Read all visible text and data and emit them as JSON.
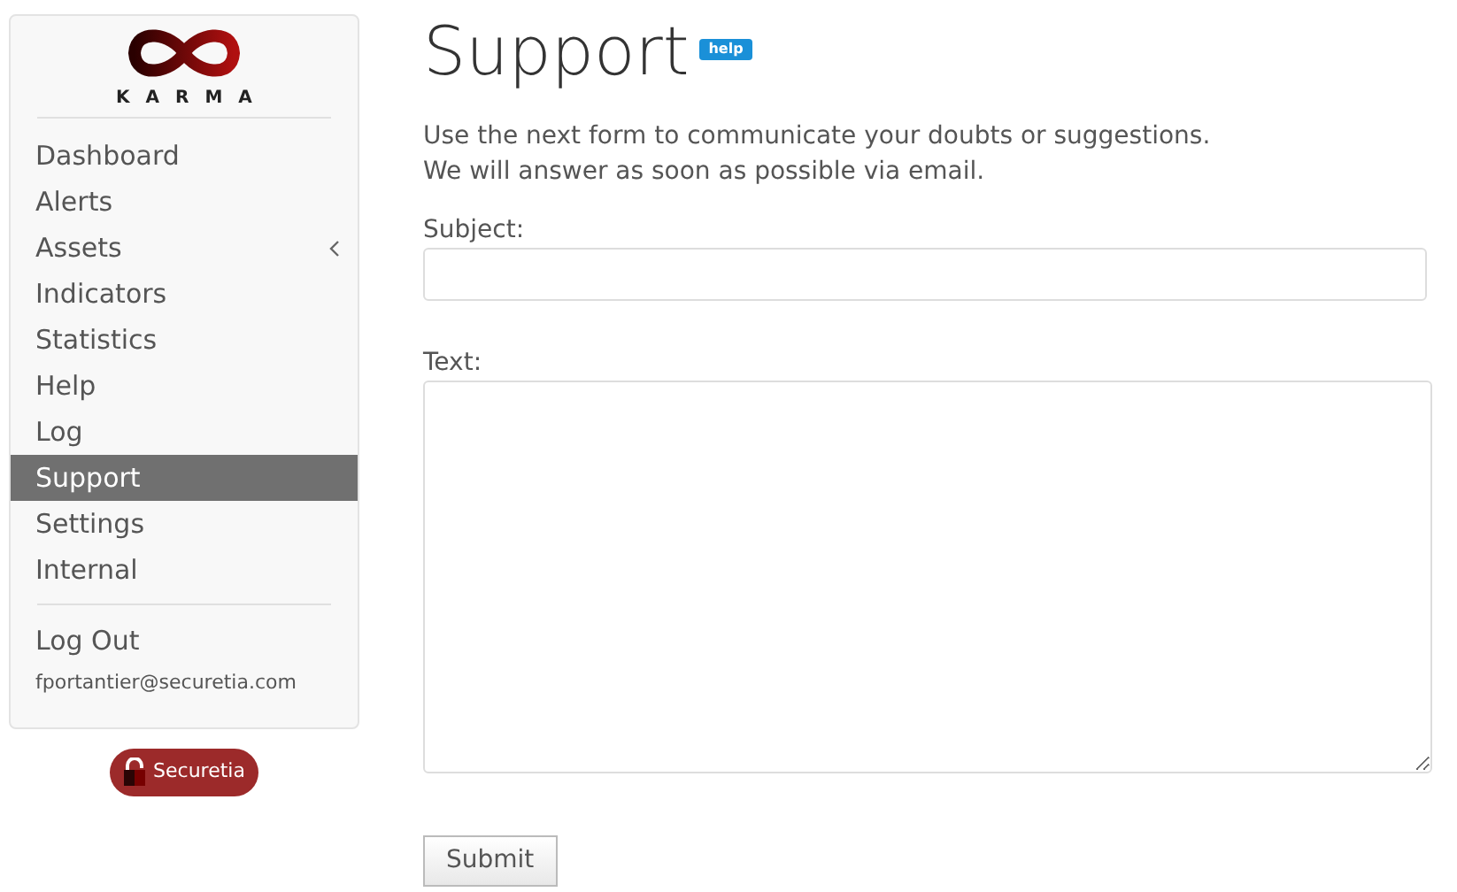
{
  "sidebar": {
    "logo_text": "KARMA",
    "items": [
      {
        "label": "Dashboard",
        "kind": "link",
        "selected": false
      },
      {
        "label": "Alerts",
        "kind": "link",
        "selected": false
      },
      {
        "label": "Assets",
        "kind": "submenu",
        "selected": false
      },
      {
        "label": "Indicators",
        "kind": "link",
        "selected": false
      },
      {
        "label": "Statistics",
        "kind": "link",
        "selected": false
      },
      {
        "label": "Help",
        "kind": "link",
        "selected": false
      },
      {
        "label": "Log",
        "kind": "link",
        "selected": false
      },
      {
        "label": "Support",
        "kind": "link",
        "selected": true
      },
      {
        "label": "Settings",
        "kind": "link",
        "selected": false
      },
      {
        "label": "Internal",
        "kind": "link",
        "selected": false
      }
    ],
    "logout": "Log Out",
    "user_email": "fportantier@securetia.com"
  },
  "vendor_badge": "Securetia",
  "page": {
    "title": "Support",
    "help_badge": "help",
    "intro": [
      "Use the next form to communicate your doubts or suggestions.",
      "We will answer as soon as possible via email."
    ],
    "fields": [
      {
        "label": "Subject:",
        "kind": "input"
      },
      {
        "label": "Text:",
        "kind": "textarea"
      }
    ],
    "submit": "Submit"
  }
}
